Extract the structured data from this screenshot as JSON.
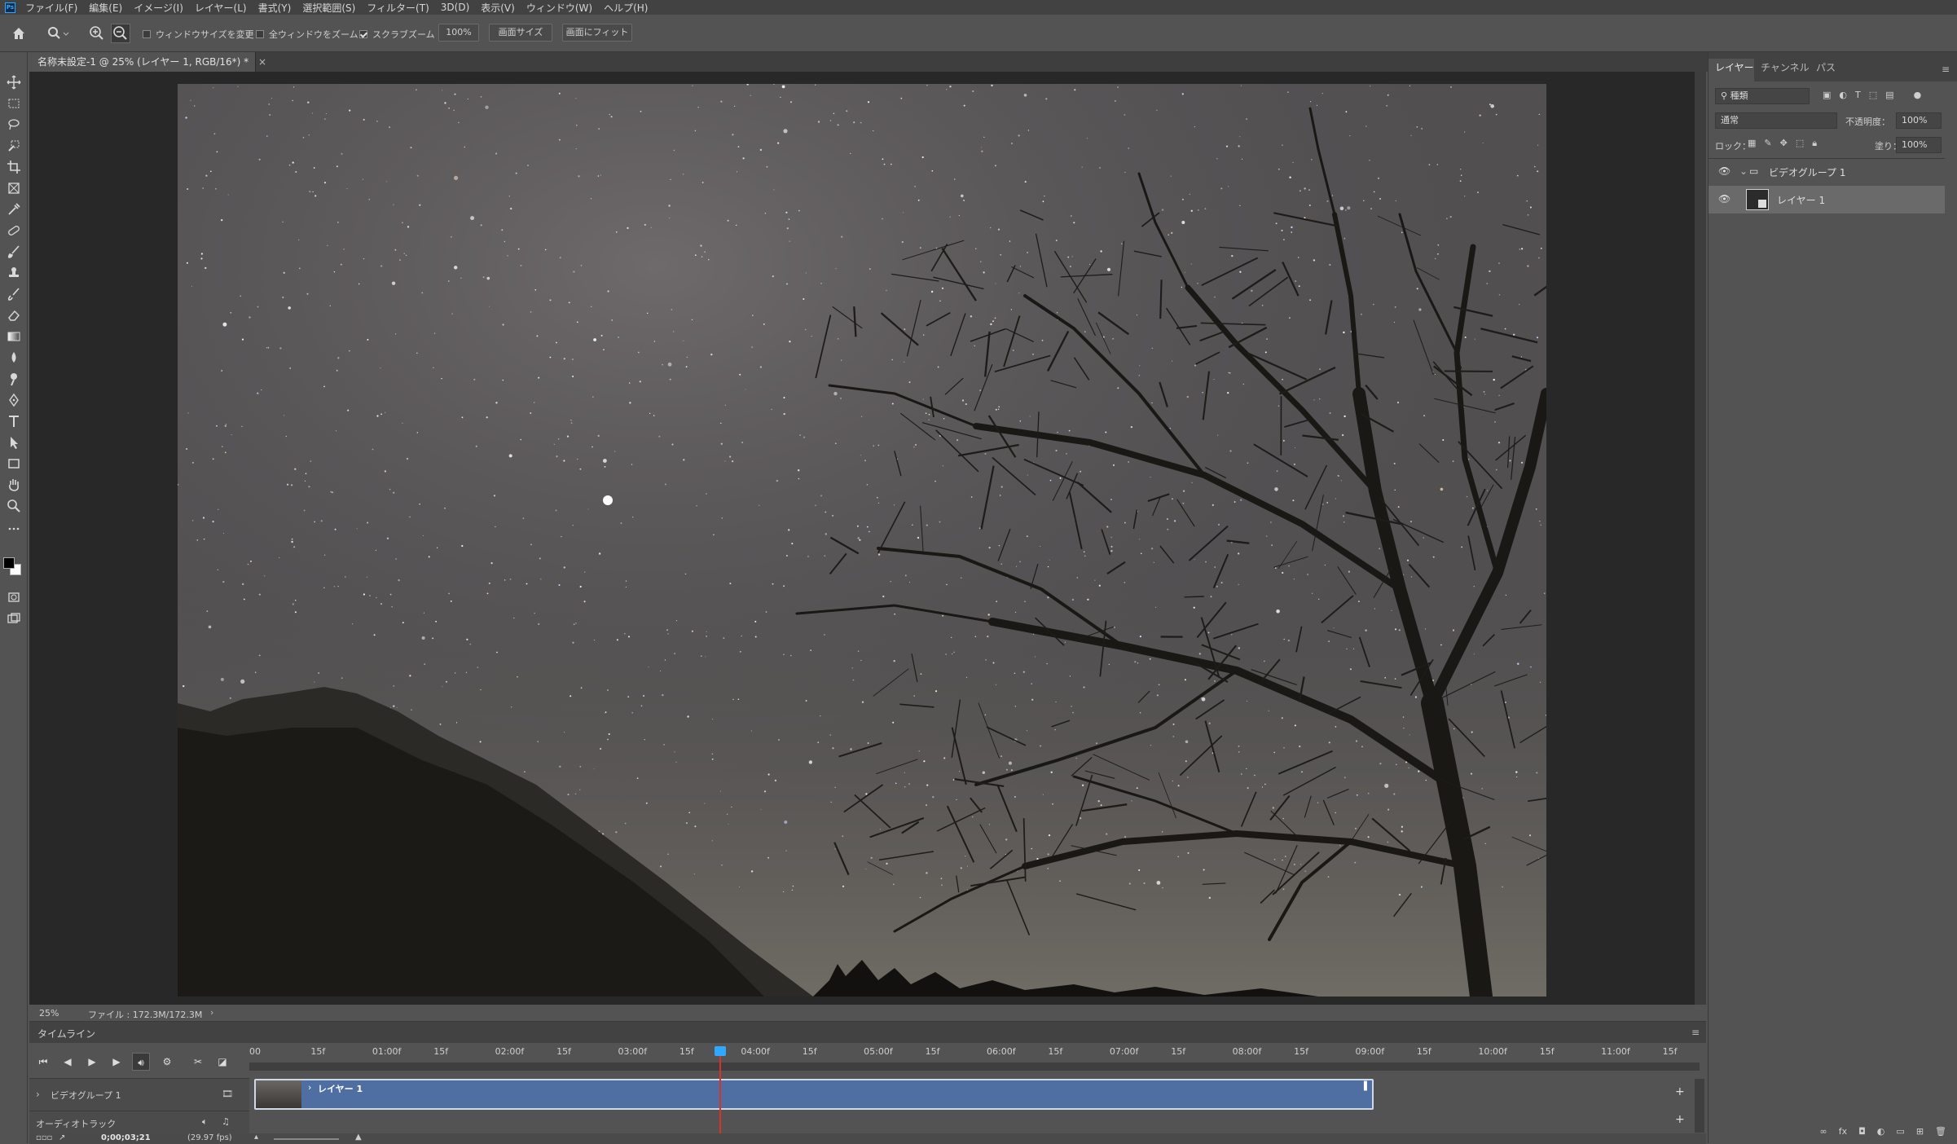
{
  "app": {
    "logo": "Ps"
  },
  "menu": [
    "ファイル(F)",
    "編集(E)",
    "イメージ(I)",
    "レイヤー(L)",
    "書式(Y)",
    "選択範囲(S)",
    "フィルター(T)",
    "3D(D)",
    "表示(V)",
    "ウィンドウ(W)",
    "ヘルプ(H)"
  ],
  "options": {
    "resize_windows": "ウィンドウサイズを変更",
    "zoom_all": "全ウィンドウをズーム",
    "scrubby_zoom": "スクラブズーム",
    "zoom_value": "100%",
    "screen_size": "画面サイズ",
    "fit_screen": "画面にフィット",
    "resize_windows_checked": false,
    "zoom_all_checked": false,
    "scrubby_zoom_checked": true
  },
  "document": {
    "tab_title": "名称未設定-1 @ 25% (レイヤー 1, RGB/16*) *",
    "zoom": "25%",
    "file_info": "ファイル : 172.3M/172.3M"
  },
  "panel": {
    "tabs": [
      "レイヤー",
      "チャンネル",
      "パス"
    ],
    "filter_kind": "種類",
    "blend_mode": "通常",
    "opacity_label": "不透明度：",
    "opacity_value": "100%",
    "lock_label": "ロック：",
    "fill_label": "塗り：",
    "fill_value": "100%",
    "layers": [
      {
        "name": "ビデオグループ 1",
        "type": "group"
      },
      {
        "name": "レイヤー 1",
        "type": "video"
      }
    ]
  },
  "timeline": {
    "title": "タイムライン",
    "ruler": [
      "00",
      "15f",
      "01:00f",
      "15f",
      "02:00f",
      "15f",
      "03:00f",
      "15f",
      "04:00f",
      "15f",
      "05:00f",
      "15f",
      "06:00f",
      "15f",
      "07:00f",
      "15f",
      "08:00f",
      "15f",
      "09:00f",
      "15f",
      "10:00f",
      "15f",
      "11:00f",
      "15f"
    ],
    "track_group": "ビデオグループ 1",
    "clip_label": "レイヤー 1",
    "audio_track": "オーディオトラック",
    "timecode": "0;00;03;21",
    "fps": "(29.97 fps)",
    "playhead_fraction": 0.324
  },
  "colors": {
    "accent": "#31a8ff",
    "clip": "#4f6fa3",
    "playhead": "#d4342c"
  }
}
